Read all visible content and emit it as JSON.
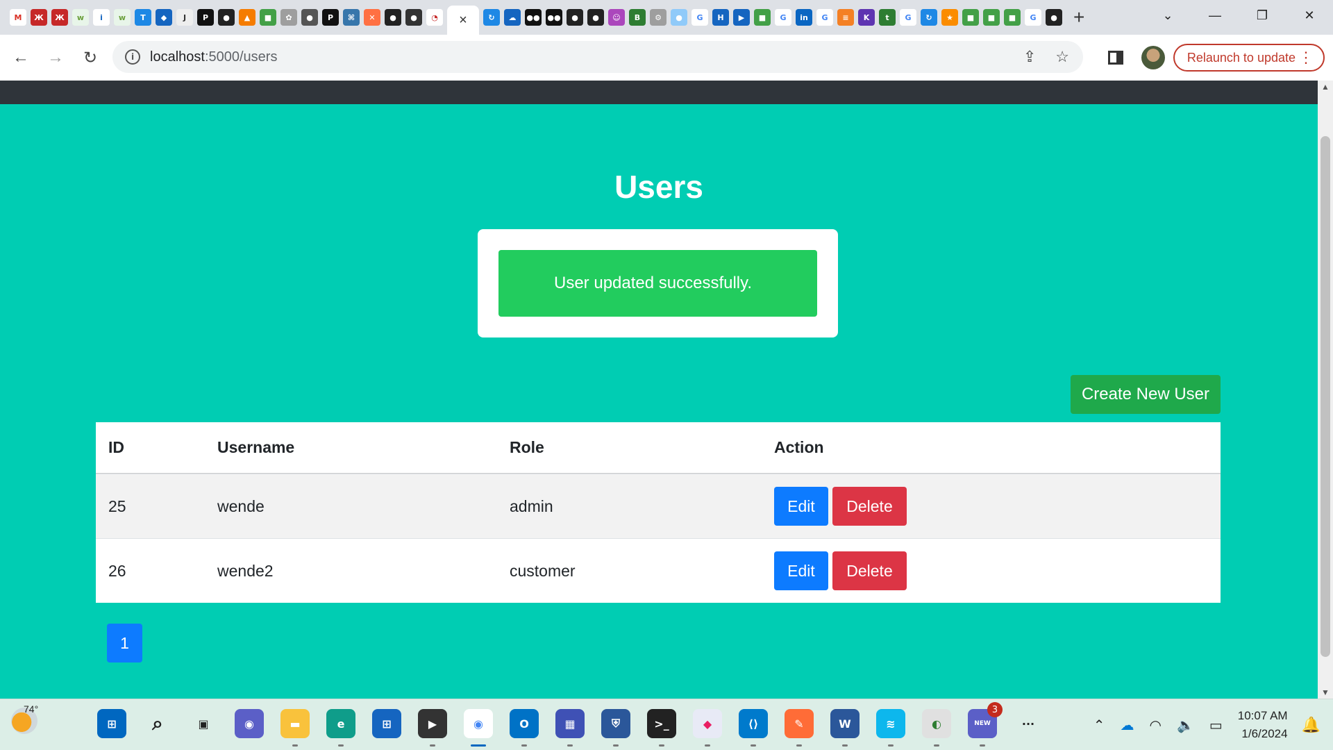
{
  "browser": {
    "active_tab_close": "×",
    "new_tab": "+",
    "url_host": "localhost",
    "url_path": ":5000/users",
    "relaunch_label": "Relaunch to update",
    "window_controls": {
      "tab_search": "⌄",
      "minimize": "—",
      "restore": "❐",
      "close": "✕"
    }
  },
  "page": {
    "title": "Users",
    "alert_message": "User updated successfully.",
    "create_button": "Create New User",
    "table": {
      "headers": [
        "ID",
        "Username",
        "Role",
        "Action"
      ],
      "rows": [
        {
          "id": "25",
          "username": "wende",
          "role": "admin"
        },
        {
          "id": "26",
          "username": "wende2",
          "role": "customer"
        }
      ],
      "edit_label": "Edit",
      "delete_label": "Delete"
    },
    "pagination": {
      "current": "1"
    }
  },
  "taskbar": {
    "weather_temp": "74°",
    "teams_badge": "3",
    "teams_tag": "NEW",
    "overflow": "···",
    "time": "10:07 AM",
    "date": "1/6/2024"
  },
  "colors": {
    "page_bg": "#00cdb3",
    "alert_bg": "#22cc5e",
    "create_btn": "#1fa94b",
    "edit_btn": "#0d7bff",
    "delete_btn": "#dc3545"
  }
}
